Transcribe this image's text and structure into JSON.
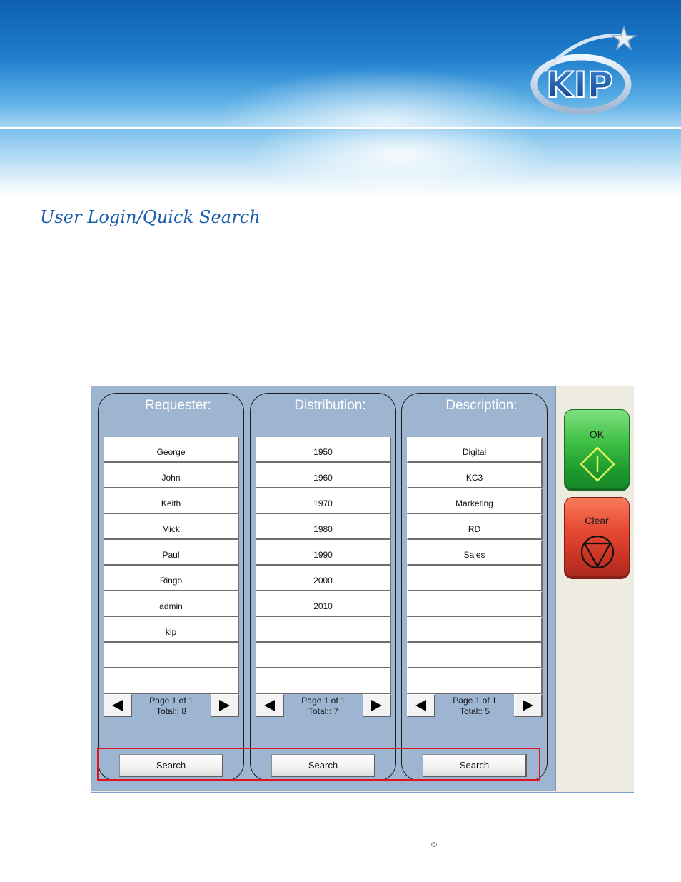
{
  "banner": {
    "logo_text": "KIP"
  },
  "page": {
    "title": "User Login/Quick Search",
    "copyright": "©"
  },
  "columns": [
    {
      "title": "Requester:",
      "items": [
        "George",
        "John",
        "Keith",
        "Mick",
        "Paul",
        "Ringo",
        "admin",
        "kip",
        "",
        ""
      ],
      "page_text": "Page 1 of 1",
      "total_text": "Total:: 8",
      "search_label": "Search"
    },
    {
      "title": "Distribution:",
      "items": [
        "1950",
        "1960",
        "1970",
        "1980",
        "1990",
        "2000",
        "2010",
        "",
        "",
        ""
      ],
      "page_text": "Page 1 of 1",
      "total_text": "Total:: 7",
      "search_label": "Search"
    },
    {
      "title": "Description:",
      "items": [
        "Digital",
        "KC3",
        "Marketing",
        "RD",
        "Sales",
        "",
        "",
        "",
        "",
        ""
      ],
      "page_text": "Page 1 of 1",
      "total_text": "Total:: 5",
      "search_label": "Search"
    }
  ],
  "actions": {
    "ok_label": "OK",
    "clear_label": "Clear"
  },
  "colors": {
    "panel_blue": "#9db5d0",
    "ok_green": "#3fbf46",
    "clear_red": "#e64a33",
    "highlight_red": "#e0121e",
    "title_blue": "#1a5fae"
  }
}
